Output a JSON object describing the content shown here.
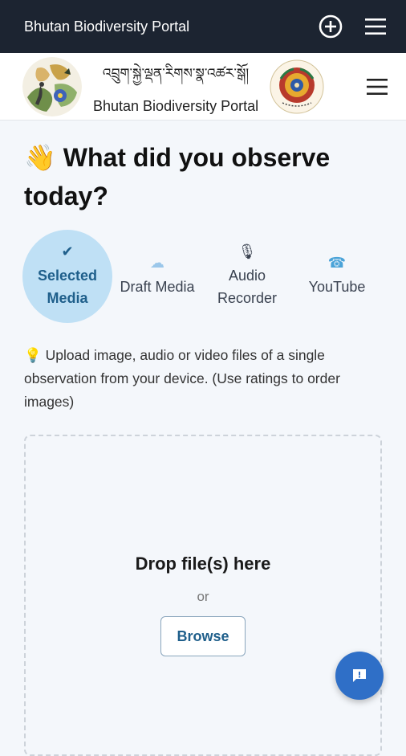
{
  "appbar": {
    "title": "Bhutan Biodiversity Portal",
    "add_icon": "plus-circle-icon",
    "menu_icon": "hamburger-menu-icon"
  },
  "site_header": {
    "title_dzongkha": "འབྲུག་སྐྱེ་ལྡན་རིགས་སྣ་འཚར་སྒོ།",
    "title_english": "Bhutan Biodiversity Portal",
    "menu_icon": "hamburger-menu-icon"
  },
  "page": {
    "heading": "👋 What did you observe today?",
    "tabs": [
      {
        "icon": "✔",
        "label": "Selected Media",
        "active": true
      },
      {
        "icon": "☁",
        "label": "Draft Media",
        "active": false
      },
      {
        "icon": "🎙",
        "label": "Audio Recorder",
        "active": false
      },
      {
        "icon": "☎",
        "label": "YouTube",
        "active": false
      }
    ],
    "hint": "💡 Upload image, audio or video files of a single observation from your device. (Use ratings to order images)",
    "dropzone": {
      "drop_text": "Drop file(s) here",
      "or_text": "or",
      "browse_label": "Browse"
    }
  },
  "fab": {
    "icon": "feedback-chat-icon"
  },
  "colors": {
    "appbar": "#1c2431",
    "accent": "#1f5f8b",
    "active_tab_bg": "#bfe0f5",
    "fab": "#2f6fc7"
  }
}
